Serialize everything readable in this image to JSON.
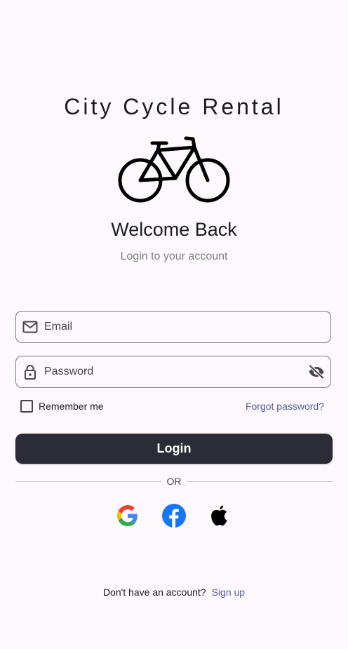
{
  "app": {
    "title": "City Cycle Rental"
  },
  "header": {
    "welcome": "Welcome Back",
    "subtitle": "Login to your account"
  },
  "form": {
    "email_placeholder": "Email",
    "password_placeholder": "Password",
    "remember_label": "Remember me",
    "remember_checked": false,
    "forgot_label": "Forgot password?",
    "login_label": "Login"
  },
  "divider": {
    "label": "OR"
  },
  "social": {
    "providers": [
      "google-icon",
      "facebook-icon",
      "apple-icon"
    ]
  },
  "footer": {
    "question": "Don't have an account?",
    "signup_label": "Sign up"
  },
  "colors": {
    "background": "#fcf8fb",
    "primary_button": "#2c2c36",
    "link": "#525b9a",
    "facebook": "#1877f2"
  }
}
